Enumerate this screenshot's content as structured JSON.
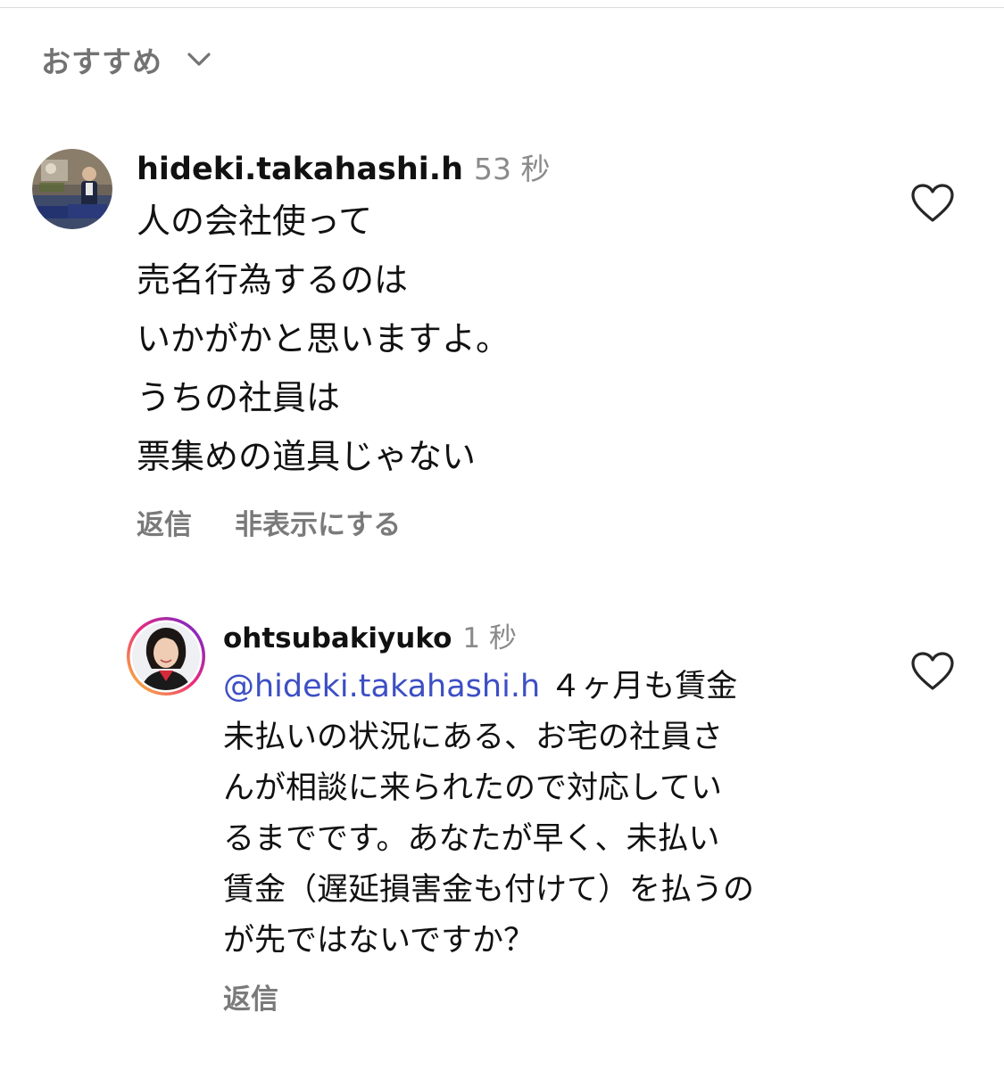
{
  "sort": {
    "label": "おすすめ",
    "icon": "chevron-down-icon"
  },
  "comments": [
    {
      "username": "hideki.takahashi.h",
      "time": "53 秒",
      "lines": [
        "人の会社使って",
        "売名行為するのは",
        "いかがかと思いますよ。",
        "うちの社員は",
        "票集めの道具じゃない"
      ],
      "actions": {
        "reply": "返信",
        "hide": "非表示にする"
      },
      "like_icon": "heart-outline-icon"
    }
  ],
  "replies": [
    {
      "username": "ohtsubakiyuko",
      "time": "1 秒",
      "mention": "@hideki.takahashi.h",
      "first_line_rest": " ４ヶ月も賃金",
      "lines": [
        "未払いの状況にある、お宅の社員さ",
        "んが相談に来られたので対応してい",
        "るまでです。あなたが早く、未払い",
        "賃金（遅延損害金も付けて）を払うの",
        "が先ではないですか？"
      ],
      "actions": {
        "reply": "返信"
      },
      "like_icon": "heart-outline-icon",
      "story_ring_colors": [
        "#f9ce34",
        "#ee2a7b",
        "#6228d7"
      ]
    }
  ]
}
